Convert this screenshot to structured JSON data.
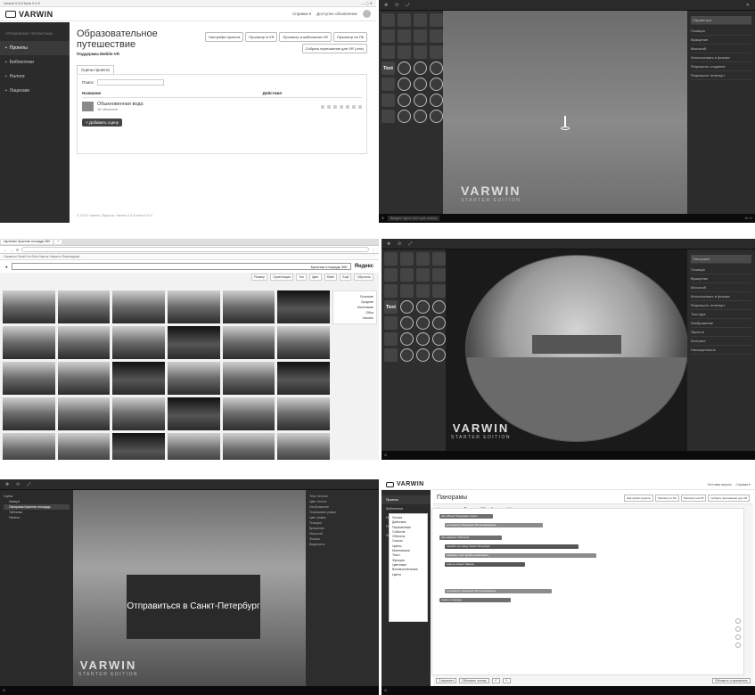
{
  "panel1": {
    "window_title": "Varwin 0.8.5 beta 0.9.0",
    "window_controls": "— ◻ ✕",
    "brand": "VARWIN",
    "header_links": [
      "Справка ▾",
      "Доступно обновление"
    ],
    "sidebar_heading": "УПРАВЛЕНИЕ ПРОЕКТАМИ",
    "sidebar_items": [
      "Проекты",
      "Библиотеки",
      "Налоги",
      "Лицензии"
    ],
    "project_title": "Образовательное путешествие",
    "project_subtitle": "Поддержка Mobile-VR",
    "action_buttons": [
      "Настройки проекта",
      "Просмотр в VR",
      "Просмотр в мобильном VR",
      "Просмотр на ПК",
      "Собрать приложение для VR (.exe)"
    ],
    "tab_label": "Сцены проекта",
    "search_label": "Поиск:",
    "col_name": "Название",
    "col_actions": "Действия",
    "scene_name": "Обыкновенная вода",
    "scene_count": "16 объектов",
    "add_button": "+ Добавить сцену",
    "footer": "© 2021 Varwin. Версия: Varwin 0.8.5 beta 0.9.0"
  },
  "panel2": {
    "library_tiles": [
      "",
      "",
      "",
      "",
      "",
      "",
      "",
      "",
      "",
      "",
      "",
      "",
      "Text",
      "",
      "",
      "",
      "",
      "",
      "",
      "",
      "",
      "",
      "",
      "",
      "",
      "",
      "",
      ""
    ],
    "inspector_rows": [
      "Параметры",
      "Позиция",
      "Вращение",
      "Масштаб",
      "Использовать в физике",
      "Разрешить создание",
      "Разрешить телепорт"
    ],
    "watermark": "VARWIN",
    "watermark_sub": "STARTER EDITION",
    "taskbar_search": "Введите здесь текст для поиска",
    "clock": "16:14"
  },
  "panel3": {
    "tabs": [
      "картинки: Красная площадь 360",
      "+"
    ],
    "bookmarks": "Сервисы   Gmail   YouTube   Карты   Новости   Переводчик",
    "query": "Красная площадь 360",
    "engine": "Яндекс",
    "filters": [
      "Размер",
      "Ориентация",
      "Тип",
      "Цвет",
      "Файл",
      "Ещё",
      "Сбросить"
    ],
    "side_filters": [
      "Большие",
      "Средние",
      "Маленькие",
      "Обои",
      "Указать"
    ]
  },
  "panel4": {
    "inspector_rows": [
      "Панорама",
      "Позиция",
      "Вращение",
      "Масштаб",
      "Использовать в физике",
      "Разрешить телепорт",
      "Текстура",
      "Изображение",
      "Яркость",
      "Контраст",
      "Насыщенность"
    ],
    "watermark": "VARWIN",
    "watermark_sub": "STARTER EDITION"
  },
  "panel5": {
    "tree_items": [
      "Сцена",
      "Камера",
      "Панорама Красная площадь",
      "Табличка",
      "Панель"
    ],
    "sign_text": "Отправиться в Санкт-Петербург",
    "inspector_rows": [
      "Текст кнопки",
      "Цвет текста",
      "Изображение",
      "Показывать рамку",
      "Цвет рамки",
      "Позиция",
      "Вращение",
      "Масштаб",
      "Физика",
      "Видимость"
    ],
    "watermark": "VARWIN",
    "watermark_sub": "STARTER EDITION"
  },
  "panel6": {
    "brand": "VARWIN",
    "header_links": [
      "Тестовая версия",
      "Справка ▾"
    ],
    "sidebar_items": [
      "Проекты",
      "Библиотеки",
      "Налоги",
      "Пользователи",
      "Лицензии"
    ],
    "page_title": "Панорамы",
    "head_buttons": [
      "Настройки проекта",
      "Просмотр в VR",
      "Просмотр на ПК",
      "Собрать приложение для VR"
    ],
    "tabs": [
      "Сцены проекта",
      "Панорама 360",
      "Панорама 360"
    ],
    "categories": [
      "Логика",
      "Действия",
      "Переменные",
      "События",
      "Объекты",
      "Списки",
      "Циклы",
      "Математика",
      "Текст",
      "Функции",
      "Цветовые",
      "Вспомогательные",
      "Цвета"
    ],
    "blocks": [
      "при объект Панорама старте",
      "установить Панорама 360 изображение",
      "при нажатии Табличка",
      "перейти на сцену Санкт-Петербург",
      "показать текст Добро пожаловать",
      "скрыть объект Панель",
      "установить Панорама 360 изображение",
      "ждать 2 секунды"
    ],
    "bottom_buttons": [
      "Сохранить",
      "Обновить логику",
      "↶",
      "↷"
    ],
    "status": "Обновить и применить"
  }
}
